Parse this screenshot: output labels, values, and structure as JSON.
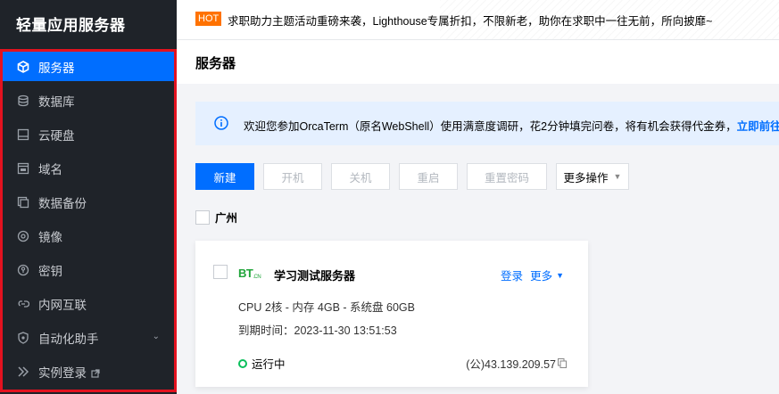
{
  "sidebar": {
    "brand": "轻量应用服务器",
    "items": [
      {
        "label": "服务器",
        "icon": "cube-icon",
        "active": true
      },
      {
        "label": "数据库",
        "icon": "database-icon"
      },
      {
        "label": "云硬盘",
        "icon": "disk-icon"
      },
      {
        "label": "域名",
        "icon": "domain-icon"
      },
      {
        "label": "数据备份",
        "icon": "backup-icon"
      },
      {
        "label": "镜像",
        "icon": "image-disc-icon"
      },
      {
        "label": "密钥",
        "icon": "key-icon"
      },
      {
        "label": "内网互联",
        "icon": "network-link-icon"
      },
      {
        "label": "自动化助手",
        "icon": "shield-icon",
        "expandable": true
      },
      {
        "label": "实例登录",
        "icon": "login-icon",
        "external": true
      }
    ]
  },
  "banner": {
    "badge": "HOT",
    "message": "求职助力主题活动重磅来袭，Lighthouse专属折扣，不限新老，助你在求职中一往无前，所向披靡~"
  },
  "page": {
    "title": "服务器"
  },
  "notice": {
    "text": "欢迎您参加OrcaTerm（原名WebShell）使用满意度调研，花2分钟填完问卷，将有机会获得代金券，",
    "link": "立即前往"
  },
  "toolbar": {
    "create": "新建",
    "start": "开机",
    "stop": "关机",
    "restart": "重启",
    "reset_password": "重置密码",
    "more_actions": "更多操作"
  },
  "region": {
    "label": "广州"
  },
  "instance": {
    "logo": "BT",
    "logo_sub": ".CN",
    "name": "学习测试服务器",
    "login": "登录",
    "more": "更多",
    "spec": "CPU 2核 - 内存 4GB - 系统盘 60GB",
    "expire_label": "到期时间：",
    "expire_value": "2023-11-30 13:51:53",
    "status": "运行中",
    "ip": "(公)43.139.209.57"
  },
  "colors": {
    "accent": "#006eff",
    "sidebar_bg": "#1f2329",
    "highlight_border": "#e3121f",
    "running": "#0abf5b",
    "hot_badge": "#ff7200"
  }
}
